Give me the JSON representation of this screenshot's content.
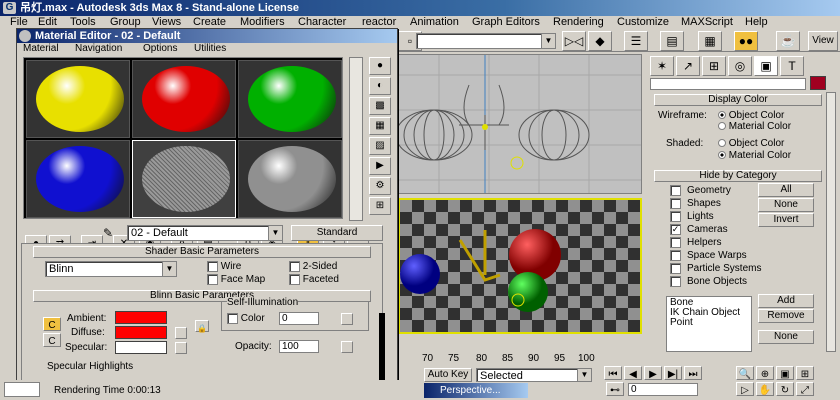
{
  "app": {
    "title": "吊灯.max - Autodesk 3ds Max 8 - Stand-alone License",
    "icon": "max-logo-icon"
  },
  "menu": [
    "File",
    "Edit",
    "Tools",
    "Group",
    "Views",
    "Create",
    "Modifiers",
    "Character",
    "reactor",
    "Animation",
    "Graph Editors",
    "Rendering",
    "Customize",
    "MAXScript",
    "Help"
  ],
  "toolbar": {
    "view_dropdown": "View"
  },
  "material_editor": {
    "title": "Material Editor - 02 - Default",
    "menu": [
      "Material",
      "Navigation",
      "Options",
      "Utilities"
    ],
    "slots": [
      {
        "color": "#e8e000",
        "label": "yellow-sphere"
      },
      {
        "color": "#e00000",
        "label": "red-sphere"
      },
      {
        "color": "#00b000",
        "label": "green-sphere"
      },
      {
        "color": "#1010d0",
        "label": "blue-sphere"
      },
      {
        "color": "#808080",
        "label": "wire-sphere"
      },
      {
        "color": "#909090",
        "label": "grey-sphere"
      }
    ],
    "material_name": "02 - Default",
    "material_type": "Standard",
    "shader_basic": {
      "header": "Shader Basic Parameters",
      "shader": "Blinn",
      "wire": "Wire",
      "two_sided": "2-Sided",
      "face_map": "Face Map",
      "faceted": "Faceted"
    },
    "blinn_basic": {
      "header": "Blinn Basic Parameters",
      "self_illum": "Self-Illumination",
      "color_label": "Color",
      "color_value": "0",
      "ambient": "Ambient:",
      "diffuse": "Diffuse:",
      "specular": "Specular:",
      "opacity_label": "Opacity:",
      "opacity_value": "100",
      "specular_highlights": "Specular Highlights"
    },
    "status": "Rendering Time  0:00:13"
  },
  "timeline": {
    "ticks": [
      "70",
      "75",
      "80",
      "85",
      "90",
      "95",
      "100"
    ]
  },
  "bottom": {
    "auto_key": "Auto Key",
    "selected": "Selected",
    "perspective_tab": "Perspective...",
    "frame": "0"
  },
  "command_panel": {
    "display_color": {
      "header": "Display Color",
      "wireframe": "Wireframe:",
      "shaded": "Shaded:",
      "object_color": "Object Color",
      "material_color": "Material Color"
    },
    "hide_by_category": {
      "header": "Hide by Category",
      "items": [
        {
          "label": "Geometry",
          "checked": false
        },
        {
          "label": "Shapes",
          "checked": false
        },
        {
          "label": "Lights",
          "checked": false
        },
        {
          "label": "Cameras",
          "checked": true
        },
        {
          "label": "Helpers",
          "checked": false
        },
        {
          "label": "Space Warps",
          "checked": false
        },
        {
          "label": "Particle Systems",
          "checked": false
        },
        {
          "label": "Bone Objects",
          "checked": false
        }
      ],
      "all": "All",
      "none": "None",
      "invert": "Invert",
      "list": [
        "Bone",
        "IK Chain Object",
        "Point"
      ],
      "add": "Add",
      "remove": "Remove",
      "none2": "None"
    }
  }
}
